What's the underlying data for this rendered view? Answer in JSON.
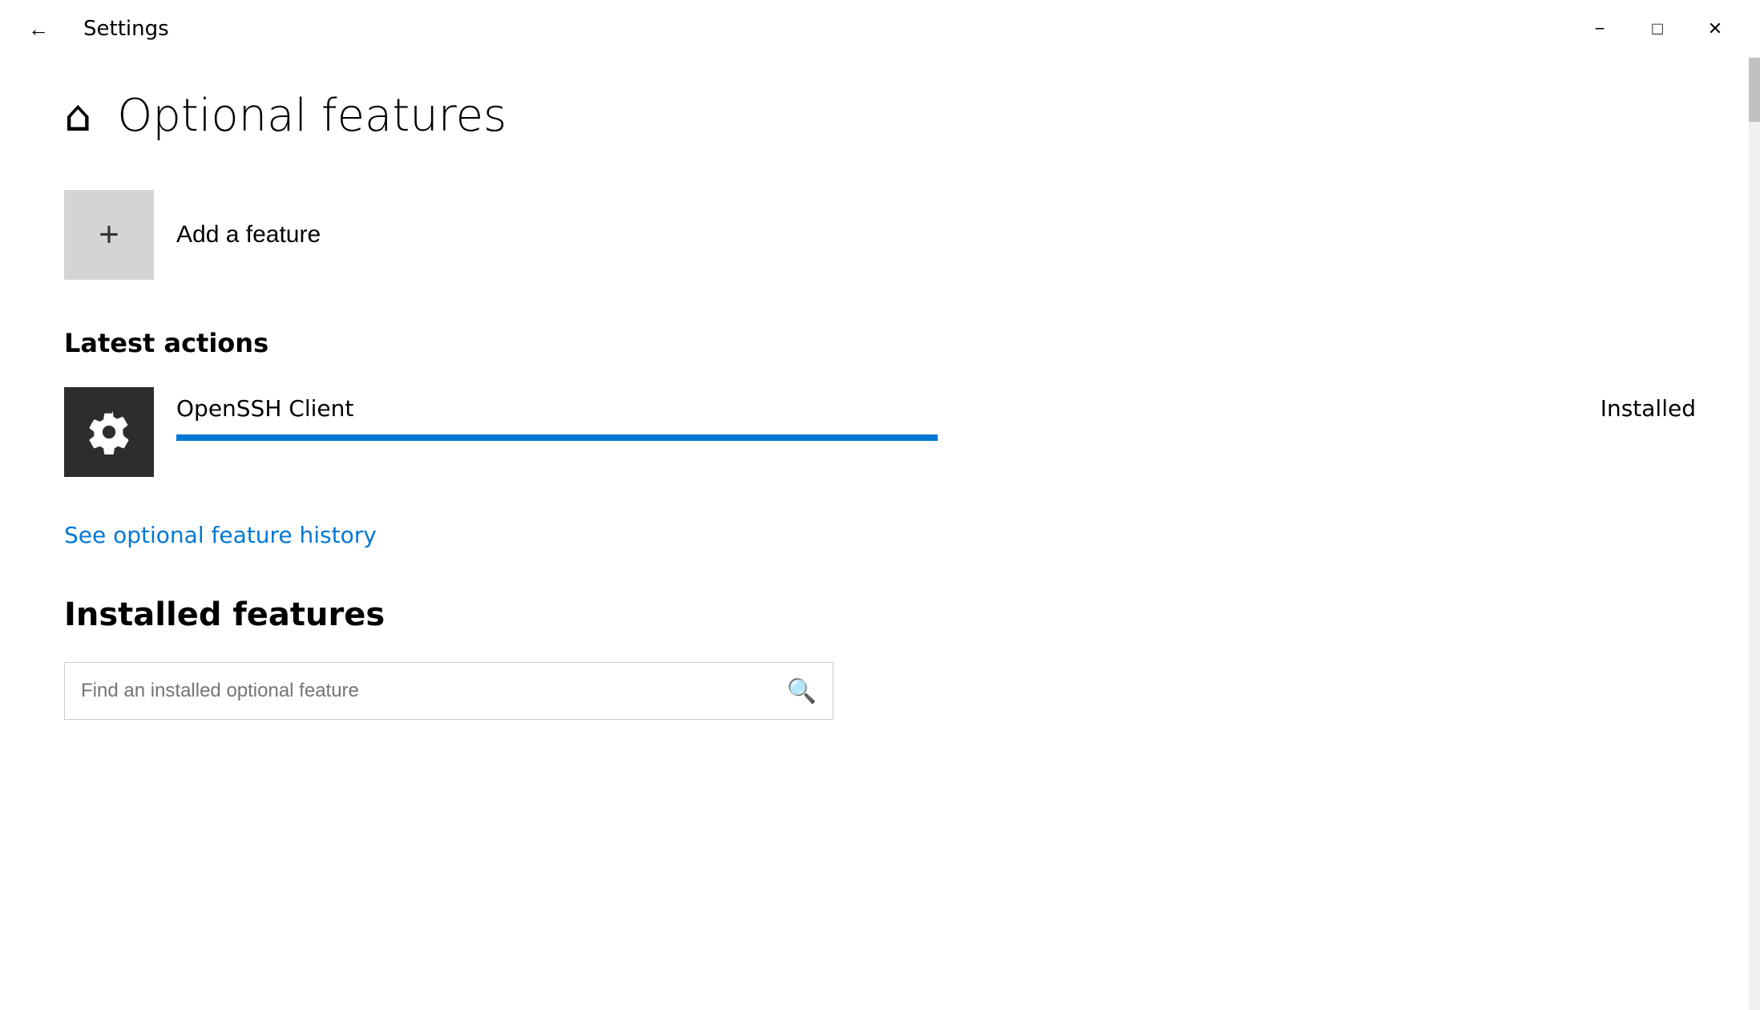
{
  "titlebar": {
    "title": "Settings",
    "minimize_label": "−",
    "maximize_label": "□",
    "close_label": "✕"
  },
  "page": {
    "home_icon": "⌂",
    "title": "Optional features"
  },
  "add_feature": {
    "icon": "+",
    "label": "Add a feature"
  },
  "latest_actions": {
    "section_title": "Latest actions",
    "items": [
      {
        "name": "OpenSSH Client",
        "status": "Installed",
        "progress_percent": 95
      }
    ]
  },
  "history_link": {
    "label": "See optional feature history"
  },
  "installed_features": {
    "section_title": "Installed features",
    "search_placeholder": "Find an installed optional feature"
  },
  "icons": {
    "search": "🔍",
    "gear": "✦"
  }
}
